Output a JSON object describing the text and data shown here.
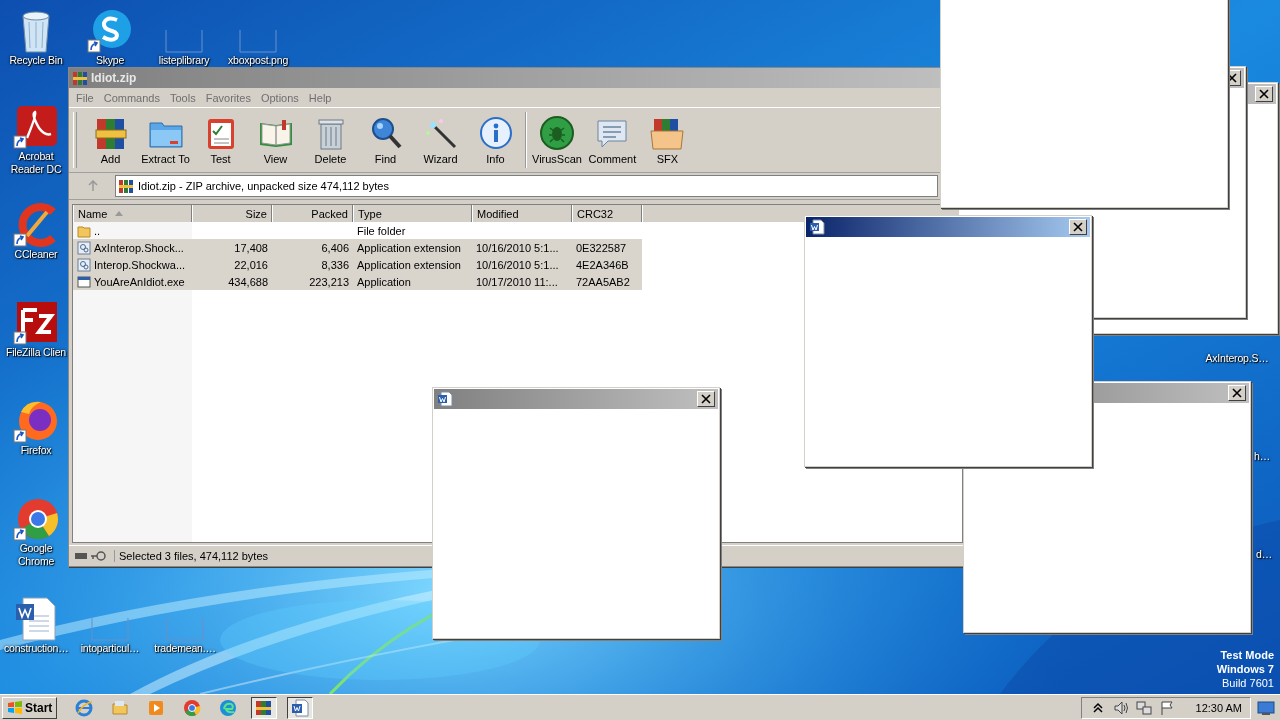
{
  "desktop_icons": [
    {
      "label": "Recycle Bin",
      "kind": "bin",
      "shortcut": false
    },
    {
      "label": "Skype",
      "kind": "skype",
      "shortcut": true
    },
    {
      "label": "listeplibrary",
      "kind": "blank",
      "shortcut": false
    },
    {
      "label": "xboxpost.png",
      "kind": "blank",
      "shortcut": false
    },
    {
      "label": "Acrobat Reader DC",
      "kind": "acrobat",
      "shortcut": true
    },
    {
      "label": "CCleaner",
      "kind": "ccleaner",
      "shortcut": true
    },
    {
      "label": "FileZilla Clien",
      "kind": "filezilla",
      "shortcut": true
    },
    {
      "label": "Firefox",
      "kind": "firefox",
      "shortcut": true
    },
    {
      "label": "Google Chrome",
      "kind": "chrome",
      "shortcut": true
    },
    {
      "label": "construction…",
      "kind": "word",
      "shortcut": false
    },
    {
      "label": "intoparticul…",
      "kind": "blank",
      "shortcut": false
    },
    {
      "label": "trademean.…",
      "kind": "blank",
      "shortcut": false
    },
    {
      "label": "AxInterop.S…",
      "kind": "covered"
    },
    {
      "label": "h…",
      "kind": "covered"
    },
    {
      "label": "d…",
      "kind": "covered"
    }
  ],
  "winrar": {
    "title": "Idiot.zip",
    "active": false,
    "menu": [
      "File",
      "Commands",
      "Tools",
      "Favorites",
      "Options",
      "Help"
    ],
    "toolbar_groups": [
      [
        {
          "label": "Add",
          "kind": "add"
        },
        {
          "label": "Extract To",
          "kind": "extract"
        },
        {
          "label": "Test",
          "kind": "test"
        },
        {
          "label": "View",
          "kind": "view"
        },
        {
          "label": "Delete",
          "kind": "delete"
        },
        {
          "label": "Find",
          "kind": "find"
        },
        {
          "label": "Wizard",
          "kind": "wizard"
        },
        {
          "label": "Info",
          "kind": "info"
        }
      ],
      [
        {
          "label": "VirusScan",
          "kind": "virusscan"
        },
        {
          "label": "Comment",
          "kind": "comment"
        },
        {
          "label": "SFX",
          "kind": "sfx"
        }
      ]
    ],
    "address": "Idiot.zip - ZIP archive, unpacked size 474,112 bytes",
    "columns": [
      {
        "label": "Name",
        "sorted": true
      },
      {
        "label": "Size",
        "sorted": false
      },
      {
        "label": "Packed",
        "sorted": false
      },
      {
        "label": "Type",
        "sorted": false
      },
      {
        "label": "Modified",
        "sorted": false
      },
      {
        "label": "CRC32",
        "sorted": false
      }
    ],
    "rows": [
      {
        "kind": "folder",
        "selected": false,
        "name": "..",
        "type": "File folder"
      },
      {
        "kind": "dll",
        "selected": true,
        "name": "AxInterop.Shock...",
        "size": "17,408",
        "packed": "6,406",
        "type": "Application extension",
        "modified": "10/16/2010 5:1...",
        "crc": "0E322587"
      },
      {
        "kind": "dll",
        "selected": true,
        "name": "Interop.Shockwa...",
        "size": "22,016",
        "packed": "8,336",
        "type": "Application extension",
        "modified": "10/16/2010 5:1...",
        "crc": "4E2A346B"
      },
      {
        "kind": "exe",
        "selected": true,
        "name": "YouAreAnIdiot.exe",
        "size": "434,688",
        "packed": "223,213",
        "type": "Application",
        "modified": "10/17/2010 11:...",
        "crc": "72AA5AB2"
      }
    ],
    "status": "Selected 3 files, 474,112 bytes"
  },
  "popups": [
    {
      "kind": "titled",
      "active": false
    },
    {
      "kind": "titled",
      "active": false
    },
    {
      "kind": "body_only"
    },
    {
      "kind": "titled",
      "active": false
    },
    {
      "kind": "titled",
      "active": true,
      "icon": true
    },
    {
      "kind": "titled",
      "active": false,
      "icon": true
    }
  ],
  "test_mode": [
    "Test Mode",
    "Windows 7",
    "Build 7601"
  ],
  "taskbar": {
    "start": "Start",
    "apps": [
      {
        "kind": "ie",
        "active": false
      },
      {
        "kind": "explorer",
        "active": false
      },
      {
        "kind": "media",
        "active": false
      },
      {
        "kind": "chrome",
        "active": false
      },
      {
        "kind": "edge",
        "active": false
      },
      {
        "kind": "winrar",
        "active": true
      },
      {
        "kind": "word",
        "active": true
      }
    ],
    "tray": [
      {
        "kind": "chevron"
      },
      {
        "kind": "speaker"
      },
      {
        "kind": "network"
      },
      {
        "kind": "flag"
      }
    ],
    "clock": "12:30 AM"
  }
}
